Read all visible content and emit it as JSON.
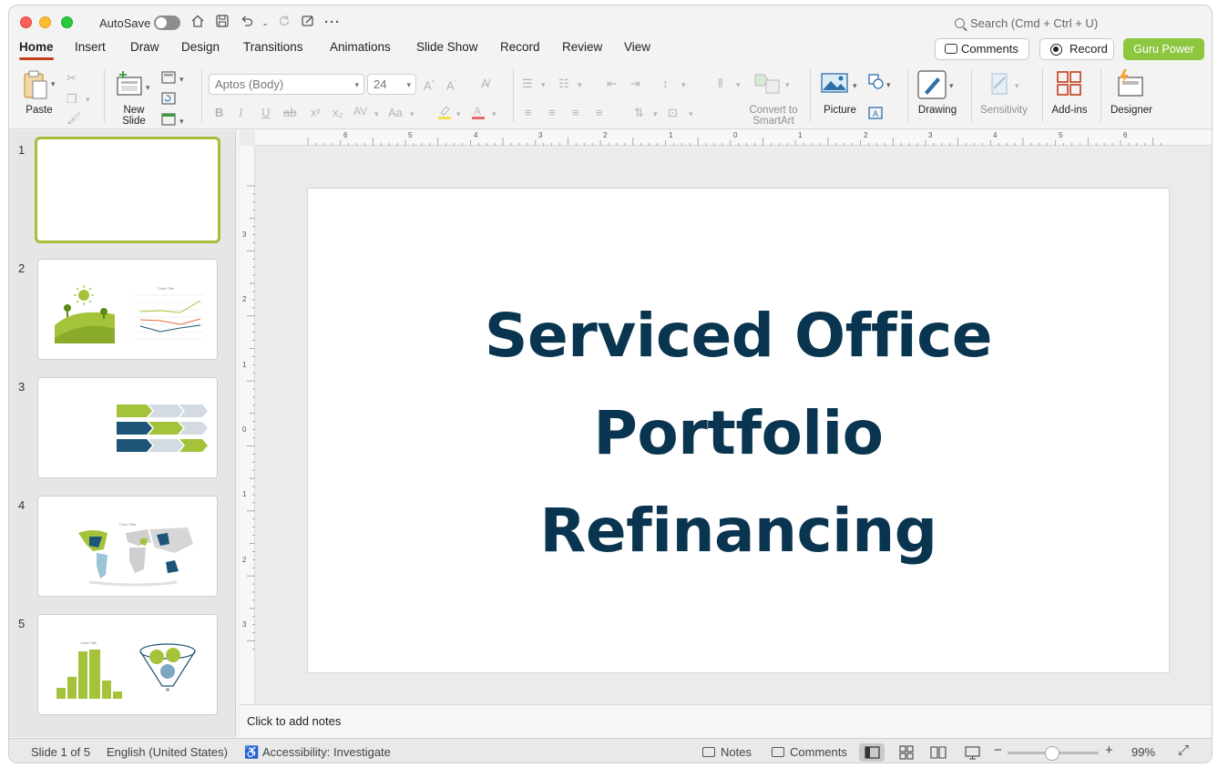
{
  "titlebar": {
    "autosave_label": "AutoSave",
    "search_placeholder": "Search (Cmd + Ctrl + U)"
  },
  "tabs": [
    "Home",
    "Insert",
    "Draw",
    "Design",
    "Transitions",
    "Animations",
    "Slide Show",
    "Record",
    "Review",
    "View"
  ],
  "active_tab": "Home",
  "header_buttons": {
    "comments": "Comments",
    "record": "Record",
    "guru": "Guru Power"
  },
  "ribbon": {
    "paste": "Paste",
    "new_slide": "New Slide",
    "new_slide_line1": "New",
    "new_slide_line2": "Slide",
    "font_name": "Aptos (Body)",
    "font_size": "24",
    "convert_smartart_line1": "Convert to",
    "convert_smartart_line2": "SmartArt",
    "picture": "Picture",
    "drawing": "Drawing",
    "sensitivity": "Sensitivity",
    "addins": "Add-ins",
    "designer": "Designer"
  },
  "slides_panel": {
    "numbers": [
      "1",
      "2",
      "3",
      "4",
      "5"
    ],
    "thumb2_chart_title": "Chart Title",
    "thumb4_chart_title": "Chart Title",
    "thumb5_chart_title": "Chart Title"
  },
  "slide": {
    "title_line1": "Serviced Office",
    "title_line2": "Portfolio",
    "title_line3": "Refinancing"
  },
  "ruler": {
    "h_labels": [
      "6",
      "5",
      "4",
      "3",
      "2",
      "1",
      "0",
      "1",
      "2",
      "3",
      "4",
      "5",
      "6"
    ],
    "v_labels": [
      "3",
      "2",
      "1",
      "0",
      "1",
      "2",
      "3"
    ]
  },
  "notes_placeholder": "Click to add notes",
  "statusbar": {
    "slide_position": "Slide 1 of 5",
    "language": "English (United States)",
    "accessibility": "Accessibility: Investigate",
    "notes": "Notes",
    "comments": "Comments",
    "zoom_level": "99%"
  },
  "colors": {
    "title_navy": "#0a3550",
    "accent_green": "#a4c33a",
    "accent_navy": "#1d5578",
    "record_tab_red": "#c43e1c",
    "guru_green": "#8dc63f"
  }
}
